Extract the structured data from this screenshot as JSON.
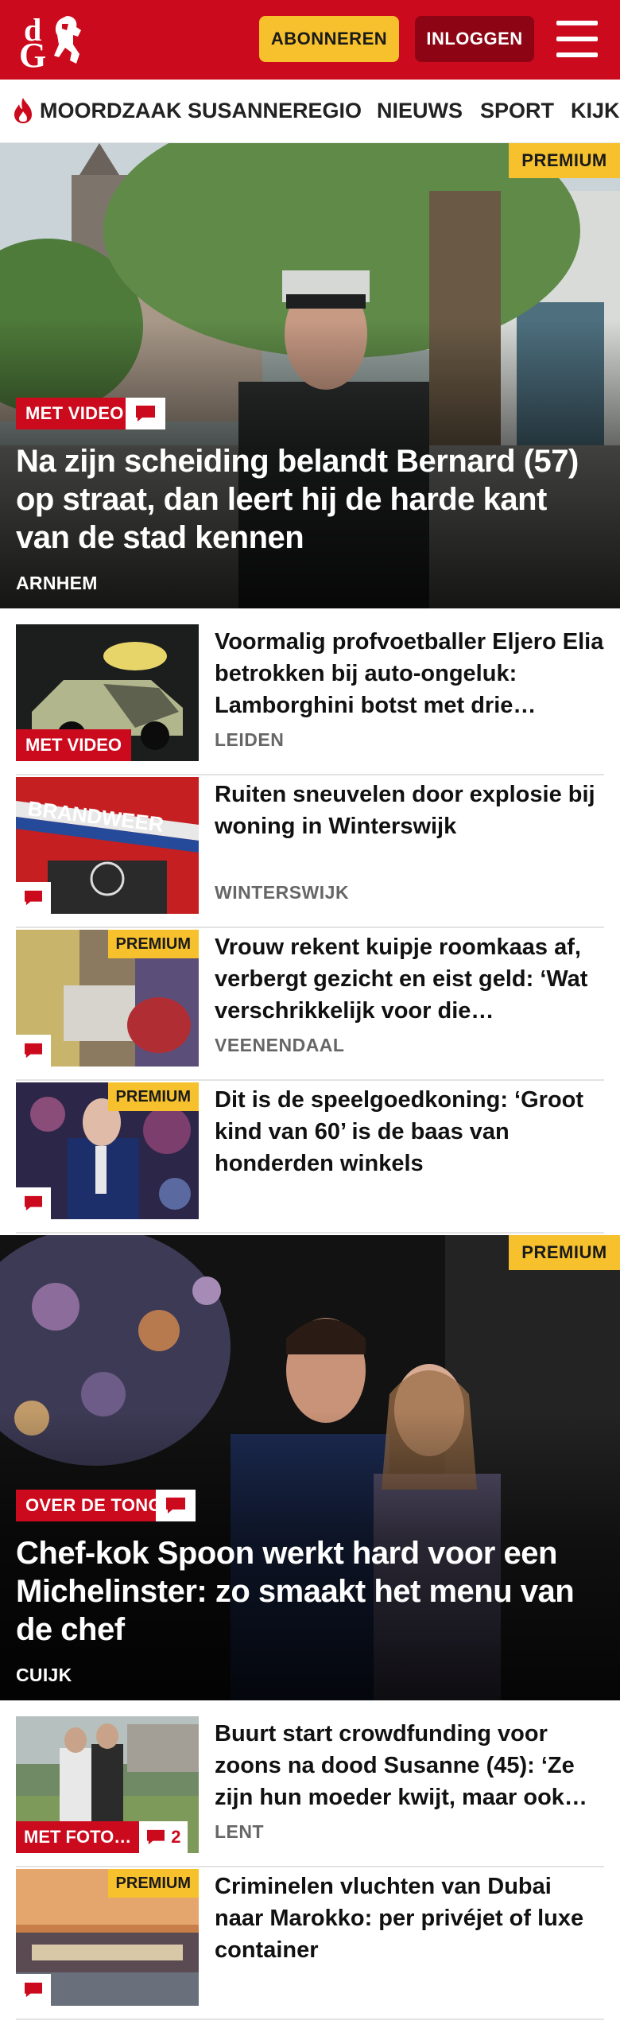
{
  "header": {
    "logo_text_top": "d",
    "logo_text_bottom": "G",
    "subscribe_label": "ABONNEREN",
    "login_label": "INLOGGEN",
    "menu_icon": "hamburger-menu-icon",
    "brand_color": "#cc0a1d",
    "subscribe_color": "#f6c12c"
  },
  "nav": {
    "items": [
      {
        "label": "MOORDZAAK SUSANNE",
        "icon": "flame-icon"
      },
      {
        "label": "REGIO"
      },
      {
        "label": "NIEUWS"
      },
      {
        "label": "SPORT"
      },
      {
        "label": "KIJK"
      }
    ]
  },
  "hero1": {
    "premium": "PREMIUM",
    "label": "MET VIDEO",
    "title": "Na zijn scheiding belandt Bernard (57) op straat, dan leert hij de harde kant van de stad kennen",
    "location": "ARNHEM"
  },
  "articles": [
    {
      "title": "Voormalig profvoetballer Eljero Elia betrokken bij auto-ongeluk: Lamborghini botst met drie…",
      "location": "LEIDEN",
      "thumb_label": "MET VIDEO"
    },
    {
      "title": "Ruiten sneuvelen door explosie bij woning in Winterswijk",
      "location": "WINTERSWIJK",
      "thumb_text": "BRANDWEER"
    },
    {
      "title": "Vrouw rekent kuipje roomkaas af, verbergt gezicht en eist geld: ‘Wat verschrikkelijk voor die…",
      "location": "VEENENDAAL",
      "premium": "PREMIUM"
    },
    {
      "title": "Dit is de speelgoedkoning: ‘Groot kind van 60’ is de baas van honderden winkels",
      "location": "",
      "premium": "PREMIUM"
    }
  ],
  "hero2": {
    "premium": "PREMIUM",
    "label": "OVER DE TONG",
    "title": "Chef-kok Spoon werkt hard voor een Michelinster: zo smaakt het menu van de chef",
    "location": "CUIJK"
  },
  "articles2": [
    {
      "title": "Buurt start crowdfunding voor zoons na dood Susanne (45): ‘Ze zijn hun moeder kwijt, maar ook…",
      "location": "LENT",
      "thumb_label": "MET FOTO…",
      "comment_count": "2"
    },
    {
      "title": "Criminelen vluchten van Dubai naar Marokko: per privéjet of luxe container",
      "location": "",
      "premium": "PREMIUM"
    }
  ]
}
